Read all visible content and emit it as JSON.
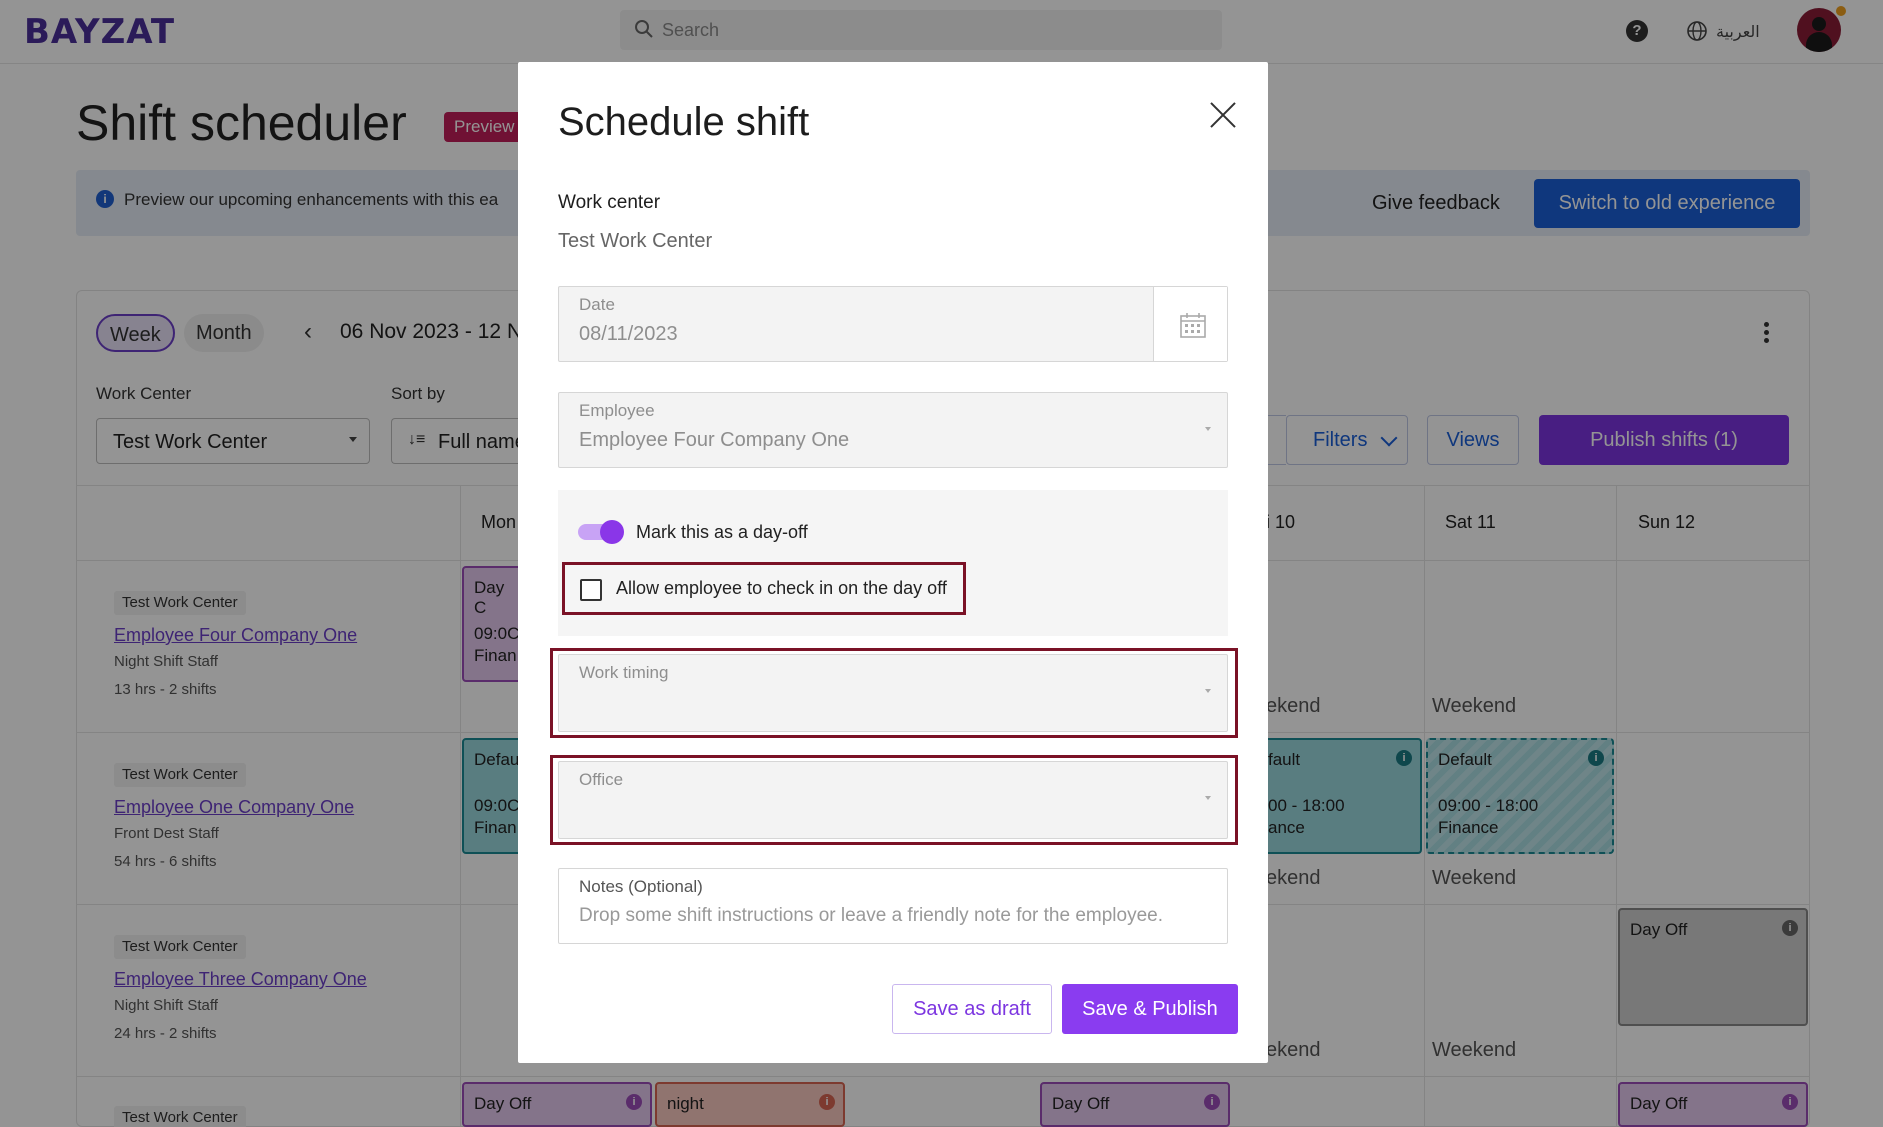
{
  "topbar": {
    "logo": "BAYZAT",
    "search_placeholder": "Search",
    "language": "العربية"
  },
  "page": {
    "title": "Shift scheduler",
    "badge": "Preview",
    "banner_text": "Preview our upcoming enhancements with this ea",
    "feedback_label": "Give feedback",
    "switch_label": "Switch to old experience"
  },
  "toolbar": {
    "week_label": "Week",
    "month_label": "Month",
    "date_range": "06 Nov 2023 - 12 N",
    "work_center_label": "Work Center",
    "work_center_value": "Test Work Center",
    "sort_label": "Sort by",
    "sort_value": "Full name",
    "filters_label": "Filters",
    "views_label": "Views",
    "publish_label": "Publish shifts (1)"
  },
  "days": [
    "Mon",
    "i 10",
    "Sat 11",
    "Sun 12"
  ],
  "employees": [
    {
      "tag": "Test Work Center",
      "name": "Employee Four Company One",
      "role": "Night Shift Staff",
      "hours": "13 hrs - 2 shifts"
    },
    {
      "tag": "Test Work Center",
      "name": "Employee One Company One",
      "role": "Front Dest Staff",
      "hours": "54 hrs - 6 shifts"
    },
    {
      "tag": "Test Work Center",
      "name": "Employee Three Company One",
      "role": "Night Shift Staff",
      "hours": "24 hrs - 2 shifts"
    },
    {
      "tag": "Test Work Center"
    }
  ],
  "cells": {
    "r1_mon": {
      "title": "Day C",
      "time": "09:0C",
      "dept": "Finan"
    },
    "r2_mon": {
      "title": "Defau",
      "time": "09:0C",
      "dept": "Finan"
    },
    "r2_fri": {
      "title": "fault",
      "time": "00 - 18:00",
      "dept": "ance"
    },
    "r2_sat": {
      "title": "Default",
      "time": "09:00 - 18:00",
      "dept": "Finance"
    },
    "r3_sun": {
      "title": "Day Off"
    },
    "r4_mon": {
      "title": "Day Off"
    },
    "r4_tue": {
      "title": "night"
    },
    "r4_thu": {
      "title": "Day Off"
    },
    "r4_sun": {
      "title": "Day Off"
    },
    "weekend_label": "Weekend",
    "weekend_partial": "ekend"
  },
  "modal": {
    "title": "Schedule shift",
    "work_center_label": "Work center",
    "work_center_value": "Test Work Center",
    "date": {
      "label": "Date",
      "value": "08/11/2023"
    },
    "employee": {
      "label": "Employee",
      "value": "Employee Four Company One"
    },
    "day_off_toggle_label": "Mark this as a day-off",
    "day_off_toggle_on": true,
    "allow_checkin_label": "Allow employee to check in on the day off",
    "allow_checkin_checked": false,
    "work_timing": {
      "label": "Work timing",
      "value": ""
    },
    "office": {
      "label": "Office",
      "value": ""
    },
    "notes": {
      "label": "Notes (Optional)",
      "placeholder": "Drop some shift instructions or leave a friendly note for the employee."
    },
    "save_draft_label": "Save as draft",
    "save_publish_label": "Save & Publish"
  },
  "colors": {
    "accent": "#8a3cf0",
    "primary_blue": "#1a5fd7",
    "highlight_border": "#7a1226",
    "day_off_purple": "#e4c9ee",
    "shift_teal": "#9ad7dd"
  }
}
